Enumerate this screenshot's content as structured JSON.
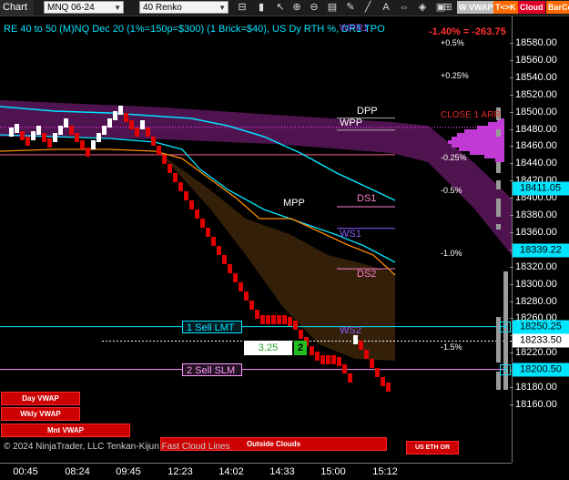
{
  "toolbar": {
    "chart_tab": "Chart",
    "instrument": "MNQ 06-24",
    "period": "40 Renko",
    "icons": [
      "price-marker-icon",
      "bar-style-icon",
      "cursor-icon",
      "zoom-in-icon",
      "zoom-out-icon",
      "properties-icon",
      "draw-icon",
      "lines-icon",
      "text-icon",
      "scroll-icon",
      "strategy-icon",
      "data-box-icon",
      "grid-icon",
      "lock-icon"
    ],
    "vwap_label": "W VWAP",
    "tk_label": "T<>K",
    "cloud_label": "Cloud",
    "barcolor_label": "BarCo"
  },
  "chart": {
    "subtitle": "RE 40 to 50 (M)NQ Dec 20 (1%=150p=$300) (1 Brick=$40), US Dy RTH %, DR1 TPO",
    "pnl": "-1.40% = -263.75",
    "pct_labels": [
      {
        "text": "+0.5%",
        "price": 18579
      },
      {
        "text": "+0.25%",
        "price": 18541
      },
      {
        "text": "-0.25%",
        "price": 18446
      },
      {
        "text": "-0.5%",
        "price": 18408
      },
      {
        "text": "-1.0%",
        "price": 18334
      },
      {
        "text": "-1.5%",
        "price": 18226
      }
    ],
    "levels": {
      "wpr": {
        "text": "WPR1",
        "price": 18596,
        "color": "#8a5cff"
      },
      "dpp": {
        "text": "DPP",
        "price": 18500,
        "color": "#ffffff"
      },
      "wpp": {
        "text": "WPP",
        "price": 18486,
        "color": "#ffffff"
      },
      "close_label": {
        "text": "CLOSE 1 ARR",
        "price": 18494,
        "color": "#e02a2a"
      },
      "ds1": {
        "text": "DS1",
        "price": 18398,
        "color": "#ff7fd0"
      },
      "mpp": {
        "text": "MPP",
        "price": 18393,
        "color": "#ffffff"
      },
      "ws1": {
        "text": "WS1",
        "price": 18357,
        "color": "#8a5cff"
      },
      "ds2": {
        "text": "DS2",
        "price": 18310,
        "color": "#ff7fd0"
      },
      "ws2": {
        "text": "WS2",
        "price": 18245,
        "color": "#8a5cff"
      }
    },
    "orders": {
      "sell_limit": {
        "label": "1 Sell LMT",
        "price": 18250.25
      },
      "sell_stop": {
        "label": "2 Sell SLM",
        "price": 18200.5
      },
      "position_value": "3.25",
      "position_qty": "2"
    },
    "buttons": {
      "day_vwap": "Day VWAP",
      "wkly_vwap": "Wkly VWAP",
      "mnt_vwap": "Mnt VWAP",
      "outside_clouds": "Outside Clouds",
      "us_eth_or": "US ETH OR"
    },
    "footer_text": "© 2024 NinjaTrader, LLC Tenkan-Kijun Fast Cloud Lines"
  },
  "price_axis": {
    "min": 18160,
    "max": 18590,
    "ticks": [
      18580,
      18560,
      18540,
      18520,
      18500,
      18480,
      18460,
      18440,
      18420,
      18400,
      18380,
      18360,
      18340,
      18320,
      18300,
      18280,
      18260,
      18240,
      18220,
      18200,
      18180,
      18160
    ],
    "tick_labels": [
      "18580.00",
      "18560.00",
      "18540.00",
      "18520.00",
      "18500.00",
      "18480.00",
      "18460.00",
      "18440.00",
      "18420.00",
      "18400.00",
      "18380.00",
      "18360.00",
      "18340.00",
      "18320.00",
      "18300.00",
      "18280.00",
      "18260.00",
      "18240.00",
      "18220.00",
      "18200.00",
      "18180.00",
      "18160.00"
    ],
    "markers": [
      {
        "text": "18411.05",
        "price": 18411.05,
        "bg": "#00e5ff",
        "fg": "#000000"
      },
      {
        "text": "18339.22",
        "price": 18339.22,
        "bg": "#00e5ff",
        "fg": "#000000"
      },
      {
        "text": "18250.25",
        "price": 18250.25,
        "bg": "#00e5ff",
        "fg": "#000000"
      },
      {
        "text": "18233.50",
        "price": 18233.5,
        "bg": "#ffffff",
        "fg": "#000000"
      },
      {
        "text": "18200.50",
        "price": 18200.5,
        "bg": "#00e5ff",
        "fg": "#000000"
      }
    ]
  },
  "time_axis": {
    "labels": [
      "00:45",
      "08:24",
      "09:45",
      "12:23",
      "14:02",
      "14:33",
      "15:00",
      "15:12"
    ]
  },
  "colors": {
    "up_brick": "#ffffff",
    "down_brick": "#e00000",
    "cyan_line": "#00e5ff",
    "orange_line": "#ff8c00",
    "cloud_purple": "#6a1b6a",
    "cloud_brown": "#3a230a"
  }
}
